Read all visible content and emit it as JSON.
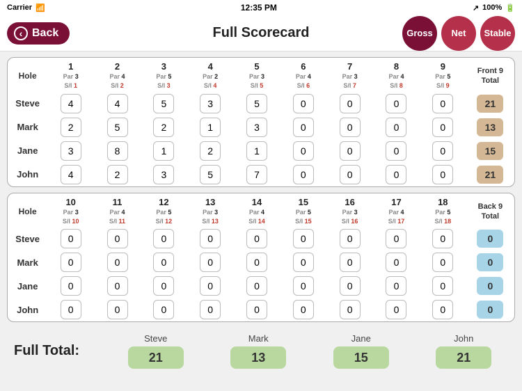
{
  "statusBar": {
    "carrier": "Carrier",
    "signal": "WiFi",
    "time": "12:35 PM",
    "battery": "100%"
  },
  "header": {
    "backLabel": "Back",
    "title": "Full Scorecard",
    "tabs": [
      {
        "label": "Gross",
        "active": true
      },
      {
        "label": "Net",
        "active": false
      },
      {
        "label": "Stable",
        "active": false
      }
    ]
  },
  "front9": {
    "sectionTitle": "Front 9",
    "holes": [
      {
        "num": "1",
        "par": "Par 3",
        "si": "S/I 1"
      },
      {
        "num": "2",
        "par": "Par 4",
        "si": "S/I 2"
      },
      {
        "num": "3",
        "par": "Par 5",
        "si": "S/I 3"
      },
      {
        "num": "4",
        "par": "Par 2",
        "si": "S/I 4"
      },
      {
        "num": "5",
        "par": "Par 3",
        "si": "S/I 5"
      },
      {
        "num": "6",
        "par": "Par 4",
        "si": "S/I 6"
      },
      {
        "num": "7",
        "par": "Par 3",
        "si": "S/I 7"
      },
      {
        "num": "8",
        "par": "Par 4",
        "si": "S/I 8"
      },
      {
        "num": "9",
        "par": "Par 5",
        "si": "S/I 9"
      }
    ],
    "totalHeader": "Front 9\nTotal",
    "players": [
      {
        "name": "Steve",
        "scores": [
          4,
          4,
          5,
          3,
          5,
          0,
          0,
          0,
          0
        ],
        "total": 21
      },
      {
        "name": "Mark",
        "scores": [
          2,
          5,
          2,
          1,
          3,
          0,
          0,
          0,
          0
        ],
        "total": 13
      },
      {
        "name": "Jane",
        "scores": [
          3,
          8,
          1,
          2,
          1,
          0,
          0,
          0,
          0
        ],
        "total": 15
      },
      {
        "name": "John",
        "scores": [
          4,
          2,
          3,
          5,
          7,
          0,
          0,
          0,
          0
        ],
        "total": 21
      }
    ]
  },
  "back9": {
    "sectionTitle": "Back 9",
    "holes": [
      {
        "num": "10",
        "par": "Par 3",
        "si": "S/I 10"
      },
      {
        "num": "11",
        "par": "Par 4",
        "si": "S/I 11"
      },
      {
        "num": "12",
        "par": "Par 5",
        "si": "S/I 12"
      },
      {
        "num": "13",
        "par": "Par 3",
        "si": "S/I 13"
      },
      {
        "num": "14",
        "par": "Par 4",
        "si": "S/I 14"
      },
      {
        "num": "15",
        "par": "Par 5",
        "si": "S/I 15"
      },
      {
        "num": "16",
        "par": "Par 3",
        "si": "S/I 16"
      },
      {
        "num": "17",
        "par": "Par 4",
        "si": "S/I 17"
      },
      {
        "num": "18",
        "par": "Par 5",
        "si": "S/I 18"
      }
    ],
    "totalHeader": "Back 9\nTotal",
    "players": [
      {
        "name": "Steve",
        "scores": [
          0,
          0,
          0,
          0,
          0,
          0,
          0,
          0,
          0
        ],
        "total": 0
      },
      {
        "name": "Mark",
        "scores": [
          0,
          0,
          0,
          0,
          0,
          0,
          0,
          0,
          0
        ],
        "total": 0
      },
      {
        "name": "Jane",
        "scores": [
          0,
          0,
          0,
          0,
          0,
          0,
          0,
          0,
          0
        ],
        "total": 0
      },
      {
        "name": "John",
        "scores": [
          0,
          0,
          0,
          0,
          0,
          0,
          0,
          0,
          0
        ],
        "total": 0
      }
    ]
  },
  "fullTotal": {
    "label": "Full Total:",
    "players": [
      {
        "name": "Steve",
        "total": 21
      },
      {
        "name": "Mark",
        "total": 13
      },
      {
        "name": "Jane",
        "total": 15
      },
      {
        "name": "John",
        "total": 21
      }
    ]
  }
}
